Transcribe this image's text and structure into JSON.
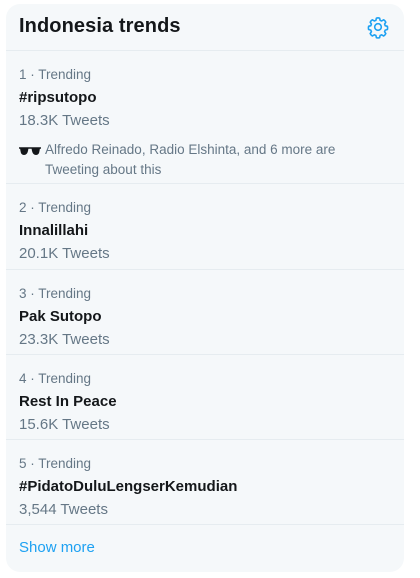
{
  "title": "Indonesia trends",
  "icons": {
    "settings": "gear-icon",
    "context": "sunglasses-icon"
  },
  "colors": {
    "accent": "#1da1f2",
    "card_background": "#f5f8fa",
    "muted_text": "#657786",
    "primary_text": "#14171a"
  },
  "trends": [
    {
      "meta": "1 · Trending",
      "name": "#ripsutopo",
      "count": "18.3K Tweets",
      "context": "Alfredo Reinado, Radio Elshinta, and 6 more are Tweeting about this"
    },
    {
      "meta": "2 · Trending",
      "name": "Innalillahi",
      "count": "20.1K Tweets"
    },
    {
      "meta": "3 · Trending",
      "name": "Pak Sutopo",
      "count": "23.3K Tweets"
    },
    {
      "meta": "4 · Trending",
      "name": "Rest In Peace",
      "count": "15.6K Tweets"
    },
    {
      "meta": "5 · Trending",
      "name": "#PidatoDuluLengserKemudian",
      "count": "3,544 Tweets"
    }
  ],
  "show_more": "Show more"
}
